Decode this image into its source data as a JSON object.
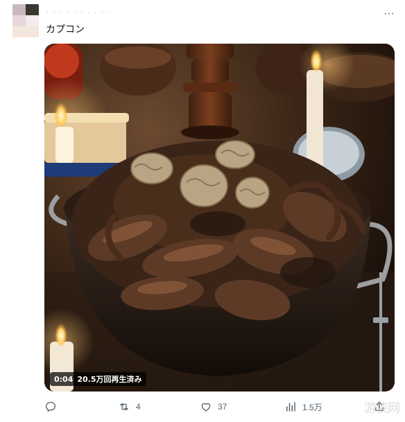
{
  "tweet": {
    "author": {
      "name": "· · · · · · · · · ·"
    },
    "text": "カプコン",
    "more_icon": "more-horizontal-icon"
  },
  "media": {
    "type": "video",
    "description": "video-thumbnail",
    "duration": "0:04",
    "views_label": "20.5万回再生済み"
  },
  "actions": {
    "reply": {
      "icon": "reply-icon",
      "count": ""
    },
    "retweet": {
      "icon": "retweet-icon",
      "count": "4"
    },
    "like": {
      "icon": "heart-icon",
      "count": "37"
    },
    "views": {
      "icon": "views-chart-icon",
      "count": "1.5万"
    },
    "share": {
      "icon": "share-icon"
    }
  },
  "watermark": "游侠网",
  "colors": {
    "text": "#0f1419",
    "muted": "#536471",
    "badge_bg": "#000000"
  }
}
